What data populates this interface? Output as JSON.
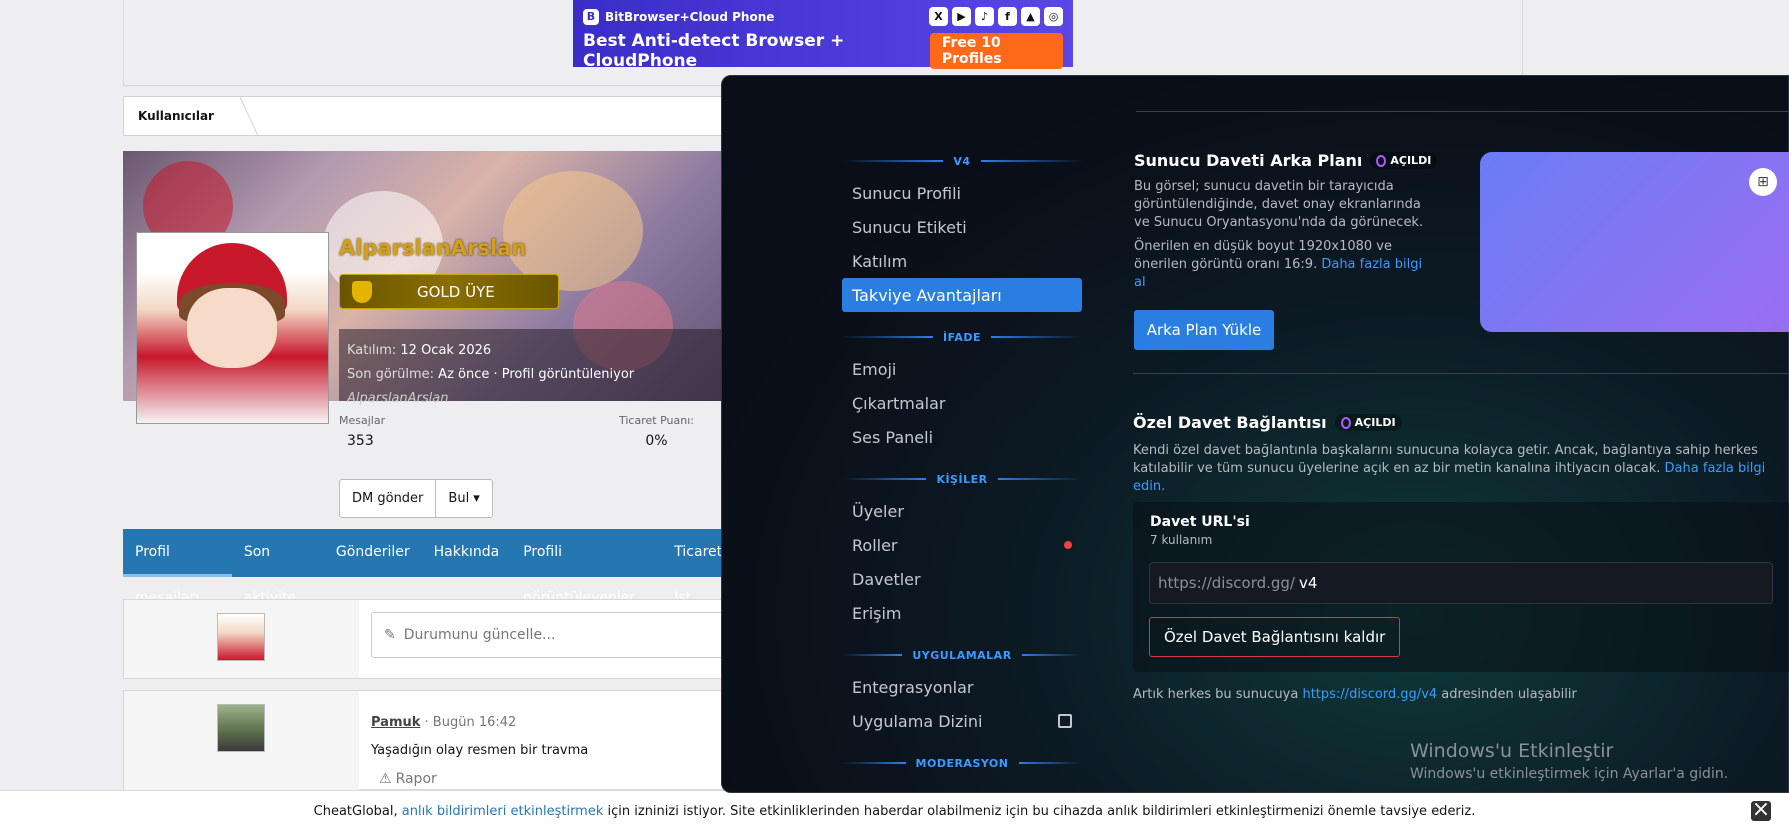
{
  "ad": {
    "brand": "BitBrowser+Cloud Phone",
    "headline": "Best Anti-detect Browser + CloudPhone",
    "cta": "Free 10 Profiles",
    "socials": [
      "X",
      "▶",
      "♪",
      "f",
      "▲",
      "◎"
    ]
  },
  "breadcrumb": {
    "label": "Kullanıcılar"
  },
  "profile": {
    "username": "AlparslanArslan",
    "rank": "GOLD ÜYE",
    "joined_label": "Katılım:",
    "joined_value": "12 Ocak 2026",
    "seen_label": "Son görülme:",
    "seen_value": "Az önce · Profil görüntüleniyor",
    "seen_user": "AlparslanArslan",
    "stat1_label": "Mesajlar",
    "stat1_value": "353",
    "stat2_label": "Ticaret Puanı:",
    "stat2_value": "0%",
    "dm_button": "DM gönder",
    "find_button": "Bul ▾"
  },
  "tabs": [
    "Profil mesajları",
    "Son aktivite",
    "Gönderiler",
    "Hakkında",
    "Profili görüntüleyenler",
    "Ticaret İst"
  ],
  "status_placeholder": "Durumunu güncelle...",
  "post": {
    "author": "Pamuk",
    "time": "· Bugün 16:42",
    "text": "Yaşadığın olay resmen bir travma",
    "report": "Rapor"
  },
  "notification": {
    "before": "CheatGlobal,",
    "link": "anlık bildirimleri etkinleştirmek",
    "after": "için izninizi istiyor. Site etkinliklerinden haberdar olabilmeniz için bu cihazda anlık bildirimleri etkinleştirmenizi önemle tavsiye ederiz."
  },
  "discord": {
    "sections": [
      {
        "title": "V4",
        "items": [
          "Sunucu Profili",
          "Sunucu Etiketi",
          "Katılım",
          "Takviye Avantajları"
        ]
      },
      {
        "title": "İFADE",
        "items": [
          "Emoji",
          "Çıkartmalar",
          "Ses Paneli"
        ]
      },
      {
        "title": "KİŞİLER",
        "items": [
          "Üyeler",
          "Roller",
          "Davetler",
          "Erişim"
        ]
      },
      {
        "title": "UYGULAMALAR",
        "items": [
          "Entegrasyonlar",
          "Uygulama Dizini"
        ]
      },
      {
        "title": "MODERASYON",
        "items": []
      }
    ],
    "bg_title": "Sunucu Daveti Arka Planı",
    "badge": "AÇILDI",
    "bg_desc1": "Bu görsel; sunucu davetin bir tarayıcıda görüntülendiğinde, davet onay ekranlarında ve Sunucu Oryantasyonu'nda da görünecek.",
    "bg_desc2": "Önerilen en düşük boyut 1920x1080 ve önerilen görüntü oranı 16:9.",
    "bg_link": "Daha fazla bilgi al",
    "upload_button": "Arka Plan Yükle",
    "vanity_title": "Özel Davet Bağlantısı",
    "vanity_desc": "Kendi özel davet bağlantınla başkalarını sunucuna kolayca getir. Ancak, bağlantıya sahip herkes katılabilir ve tüm sunucu üyelerine açık en az bir metin kanalına ihtiyacın olacak.",
    "vanity_link": "Daha fazla bilgi edin.",
    "url_title": "Davet URL'si",
    "url_uses": "7 kullanım",
    "url_prefix": "https://discord.gg/",
    "url_value": "v4",
    "remove_button": "Özel Davet Bağlantısını kaldır",
    "footer_before": "Artık herkes bu sunucuya",
    "footer_link": "https://discord.gg/v4",
    "footer_after": "adresinden ulaşabilir",
    "win_title": "Windows'u Etkinleştir",
    "win_sub": "Windows'u etkinleştirmek için Ayarlar'a gidin."
  },
  "colors": {
    "accent": "#2a7de1",
    "forum_blue": "#2577b1",
    "gold": "#d4a017",
    "danger": "#da373c"
  }
}
